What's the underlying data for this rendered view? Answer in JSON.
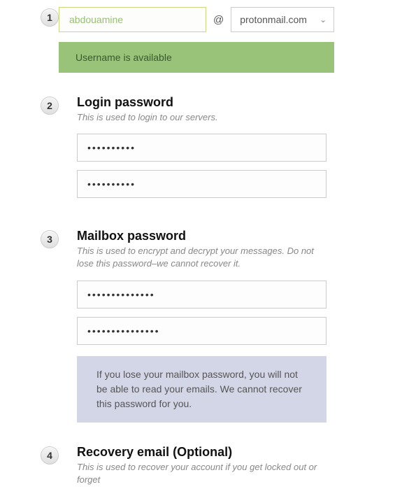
{
  "step1": {
    "number": "1",
    "username_value": "abdouamine",
    "at": "@",
    "domain": "protonmail.com",
    "success_message": "Username is available"
  },
  "step2": {
    "number": "2",
    "title": "Login password",
    "desc": "This is used to login to our servers.",
    "pw1": "••••••••••",
    "pw2": "••••••••••"
  },
  "step3": {
    "number": "3",
    "title": "Mailbox password",
    "desc": "This is used to encrypt and decrypt your messages. Do not lose this password–we cannot recover it.",
    "pw1": "••••••••••••••",
    "pw2": "•••••••••••••••",
    "warning": "If you lose your mailbox password, you will not be able to read your emails. We cannot recover this password for you."
  },
  "step4": {
    "number": "4",
    "title_pre": "Recovery email ",
    "title_opt": "(Optional)",
    "desc": "This is used to recover your account if you get locked out or forget"
  }
}
